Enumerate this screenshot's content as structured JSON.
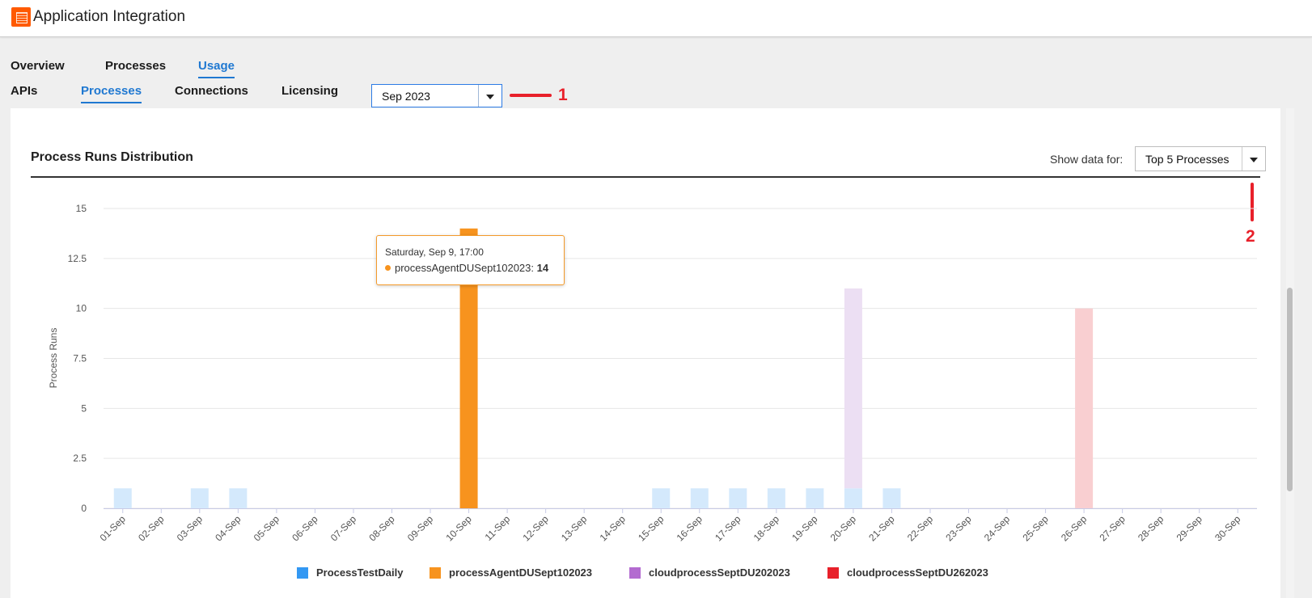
{
  "app": {
    "title": "Application Integration"
  },
  "nav": {
    "primary_tabs": [
      {
        "label": "Overview",
        "active": false
      },
      {
        "label": "Processes",
        "active": false
      },
      {
        "label": "Usage",
        "active": true
      }
    ],
    "secondary_tabs": [
      {
        "label": "APIs",
        "active": false
      },
      {
        "label": "Processes",
        "active": true
      },
      {
        "label": "Connections",
        "active": false
      },
      {
        "label": "Licensing",
        "active": false
      }
    ]
  },
  "month_select": {
    "value": "Sep 2023"
  },
  "annotations": {
    "one": "1",
    "two": "2"
  },
  "panel": {
    "title": "Process Runs Distribution",
    "show_data_label": "Show data for:",
    "show_data_value": "Top 5 Processes"
  },
  "tooltip": {
    "date": "Saturday, Sep 9, 17:00",
    "series": "processAgentDUSept102023",
    "value": "14"
  },
  "colors": {
    "accent": "#1f78d1",
    "annotation": "#e8202a",
    "series": [
      "#3398f3",
      "#f7931e",
      "#b36bd0",
      "#e8202a"
    ],
    "series_faded": [
      "#d4e9fc",
      "#fcd3a5",
      "#ecdff3",
      "#f9cfd1"
    ]
  },
  "chart_data": {
    "type": "bar",
    "stacked": true,
    "ylabel": "Process Runs",
    "ylim": [
      0,
      15
    ],
    "yticks": [
      "0",
      "2.5",
      "5",
      "7.5",
      "10",
      "12.5",
      "15"
    ],
    "grid": true,
    "legend_position": "bottom",
    "highlighted_series": "processAgentDUSept102023",
    "categories": [
      "01-Sep",
      "02-Sep",
      "03-Sep",
      "04-Sep",
      "05-Sep",
      "06-Sep",
      "07-Sep",
      "08-Sep",
      "09-Sep",
      "10-Sep",
      "11-Sep",
      "12-Sep",
      "13-Sep",
      "14-Sep",
      "15-Sep",
      "16-Sep",
      "17-Sep",
      "18-Sep",
      "19-Sep",
      "20-Sep",
      "21-Sep",
      "22-Sep",
      "23-Sep",
      "24-Sep",
      "25-Sep",
      "26-Sep",
      "27-Sep",
      "28-Sep",
      "29-Sep",
      "30-Sep"
    ],
    "series": [
      {
        "name": "ProcessTestDaily",
        "values": [
          1,
          0,
          1,
          1,
          0,
          0,
          0,
          0,
          0,
          0,
          0,
          0,
          0,
          0,
          1,
          1,
          1,
          1,
          1,
          1,
          1,
          0,
          0,
          0,
          0,
          0,
          0,
          0,
          0,
          0
        ]
      },
      {
        "name": "processAgentDUSept102023",
        "values": [
          0,
          0,
          0,
          0,
          0,
          0,
          0,
          0,
          0,
          14,
          0,
          0,
          0,
          0,
          0,
          0,
          0,
          0,
          0,
          0,
          0,
          0,
          0,
          0,
          0,
          0,
          0,
          0,
          0,
          0
        ]
      },
      {
        "name": "cloudprocessSeptDU202023",
        "values": [
          0,
          0,
          0,
          0,
          0,
          0,
          0,
          0,
          0,
          0,
          0,
          0,
          0,
          0,
          0,
          0,
          0,
          0,
          0,
          10,
          0,
          0,
          0,
          0,
          0,
          0,
          0,
          0,
          0,
          0
        ]
      },
      {
        "name": "cloudprocessSeptDU262023",
        "values": [
          0,
          0,
          0,
          0,
          0,
          0,
          0,
          0,
          0,
          0,
          0,
          0,
          0,
          0,
          0,
          0,
          0,
          0,
          0,
          0,
          0,
          0,
          0,
          0,
          0,
          10,
          0,
          0,
          0,
          0
        ]
      }
    ]
  }
}
